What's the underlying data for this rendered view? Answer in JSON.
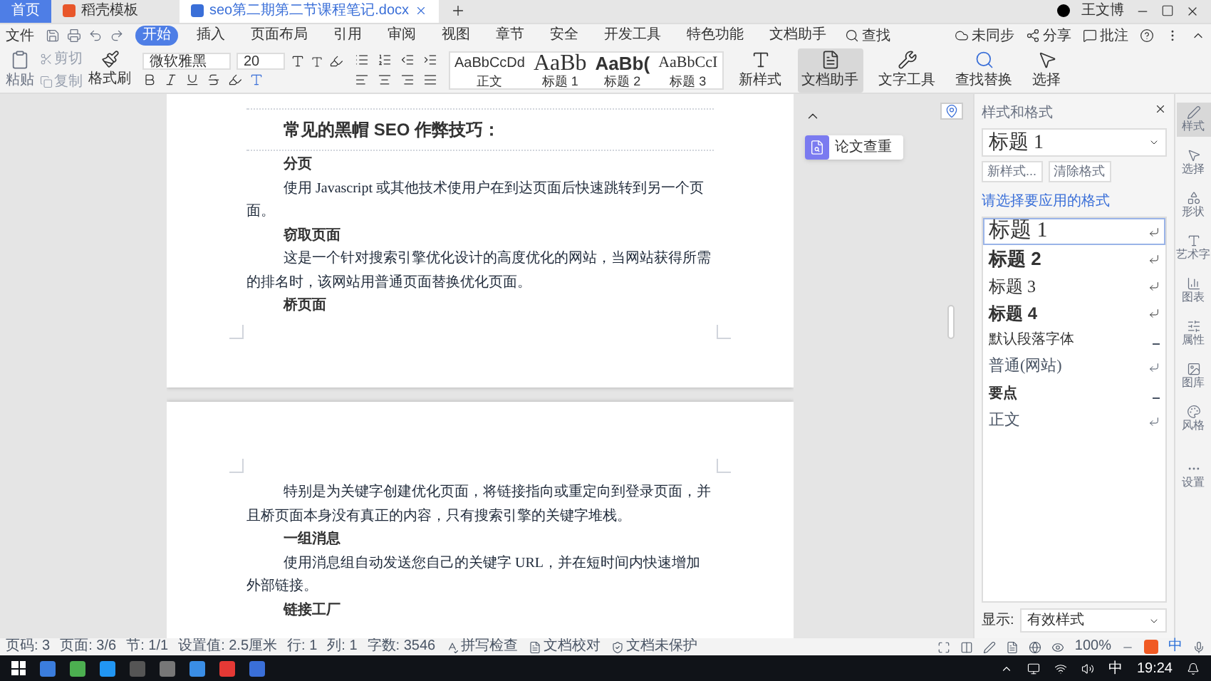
{
  "tabs": [
    {
      "label": "首页",
      "kind": "home",
      "selected": false
    },
    {
      "label": "稻壳模板",
      "kind": "template",
      "selected": false
    },
    {
      "label": "seo第二期第二节课程笔记.docx",
      "kind": "doc",
      "selected": true
    }
  ],
  "user": {
    "name": "王文博"
  },
  "menu": {
    "file": "文件",
    "items": [
      {
        "label": "开始",
        "selected": true
      },
      {
        "label": "插入",
        "selected": false
      },
      {
        "label": "页面布局",
        "selected": false
      },
      {
        "label": "引用",
        "selected": false
      },
      {
        "label": "审阅",
        "selected": false
      },
      {
        "label": "视图",
        "selected": false
      },
      {
        "label": "章节",
        "selected": false
      },
      {
        "label": "安全",
        "selected": false
      },
      {
        "label": "开发工具",
        "selected": false
      },
      {
        "label": "特色功能",
        "selected": false
      },
      {
        "label": "文档助手",
        "selected": false
      }
    ],
    "search": "查找",
    "sync": "未同步",
    "share": "分享",
    "comment": "批注"
  },
  "ribbon": {
    "paste": "粘贴",
    "cut": "剪切",
    "copy": "复制",
    "painter": "格式刷",
    "font_name": "微软雅黑",
    "font_size": "20",
    "styles": [
      {
        "preview": "AaBbCcDd",
        "label": "正文",
        "kind": "body"
      },
      {
        "preview": "AaBb",
        "label": "标题 1",
        "kind": "h1"
      },
      {
        "preview": "AaBb(",
        "label": "标题 2",
        "kind": "h2"
      },
      {
        "preview": "AaBbCcI",
        "label": "标题 3",
        "kind": "h3"
      }
    ],
    "tools": [
      {
        "label": "新样式",
        "kind": "style",
        "selected": false
      },
      {
        "label": "文档助手",
        "kind": "assistant",
        "selected": true
      },
      {
        "label": "文字工具",
        "kind": "tool",
        "selected": false
      },
      {
        "label": "查找替换",
        "kind": "find",
        "selected": false
      },
      {
        "label": "选择",
        "kind": "select",
        "selected": false
      }
    ]
  },
  "pages": [
    {
      "blocks": [
        {
          "kind": "title",
          "text": "常见的黑帽 SEO 作弊技巧："
        },
        {
          "kind": "heading",
          "text": "分页"
        },
        {
          "kind": "para",
          "text": "使用 Javascript 或其他技术使用户在到达页面后快速跳转到另一个页面。"
        },
        {
          "kind": "heading",
          "text": "窃取页面"
        },
        {
          "kind": "para",
          "text": "这是一个针对搜索引擎优化设计的高度优化的网站，当网站获得所需的排名时，该网站用普通页面替换优化页面。"
        },
        {
          "kind": "heading",
          "text": "桥页面"
        }
      ]
    },
    {
      "blocks": [
        {
          "kind": "para",
          "text": "特别是为关键字创建优化页面，将链接指向或重定向到登录页面，并且桥页面本身没有真正的内容，只有搜索引擎的关键字堆栈。"
        },
        {
          "kind": "heading",
          "text": "一组消息"
        },
        {
          "kind": "para",
          "text": "使用消息组自动发送您自己的关键字 URL，并在短时间内快速增加外部链接。"
        },
        {
          "kind": "heading",
          "text": "链接工厂"
        }
      ]
    }
  ],
  "paper_check": "论文查重",
  "styles_pane": {
    "title": "样式和格式",
    "current": "标题 1",
    "buttons": [
      "新样式...",
      "清除格式"
    ],
    "prompt": "请选择要应用的格式",
    "items": [
      {
        "label": "标题 1",
        "kind": "h1",
        "selected": true
      },
      {
        "label": "标题 2",
        "kind": "h2",
        "selected": false
      },
      {
        "label": "标题 3",
        "kind": "h3",
        "selected": false
      },
      {
        "label": "标题 4",
        "kind": "h4",
        "selected": false
      },
      {
        "label": "默认段落字体",
        "kind": "char",
        "selected": false
      },
      {
        "label": "普通(网站)",
        "kind": "serif",
        "selected": false
      },
      {
        "label": "要点",
        "kind": "strong",
        "selected": false
      },
      {
        "label": "正文",
        "kind": "serif",
        "selected": false
      }
    ],
    "show_label": "显示:",
    "show_value": "有效样式"
  },
  "side_tabs": [
    {
      "label": "样式",
      "kind": "style",
      "selected": true
    },
    {
      "label": "选择",
      "kind": "select",
      "selected": false
    },
    {
      "label": "形状",
      "kind": "shape",
      "selected": false
    },
    {
      "label": "艺术字",
      "kind": "art",
      "selected": false
    },
    {
      "label": "图表",
      "kind": "chart",
      "selected": false
    },
    {
      "label": "属性",
      "kind": "props",
      "selected": false
    },
    {
      "label": "图库",
      "kind": "gallery",
      "selected": false
    },
    {
      "label": "风格",
      "kind": "theme",
      "selected": false
    },
    {
      "label": "设置",
      "kind": "settings",
      "selected": false
    }
  ],
  "status": {
    "items": [
      "页码: 3",
      "页面: 3/6",
      "节: 1/1",
      "设置值: 2.5厘米",
      "行: 1",
      "列: 1",
      "字数: 3546"
    ],
    "spell": "拼写检查",
    "proof": "文档校对",
    "protect": "文档未保护",
    "zoom": "100%"
  },
  "taskbar": {
    "ime": "中",
    "tray_ime": "中",
    "time": "19:24"
  }
}
